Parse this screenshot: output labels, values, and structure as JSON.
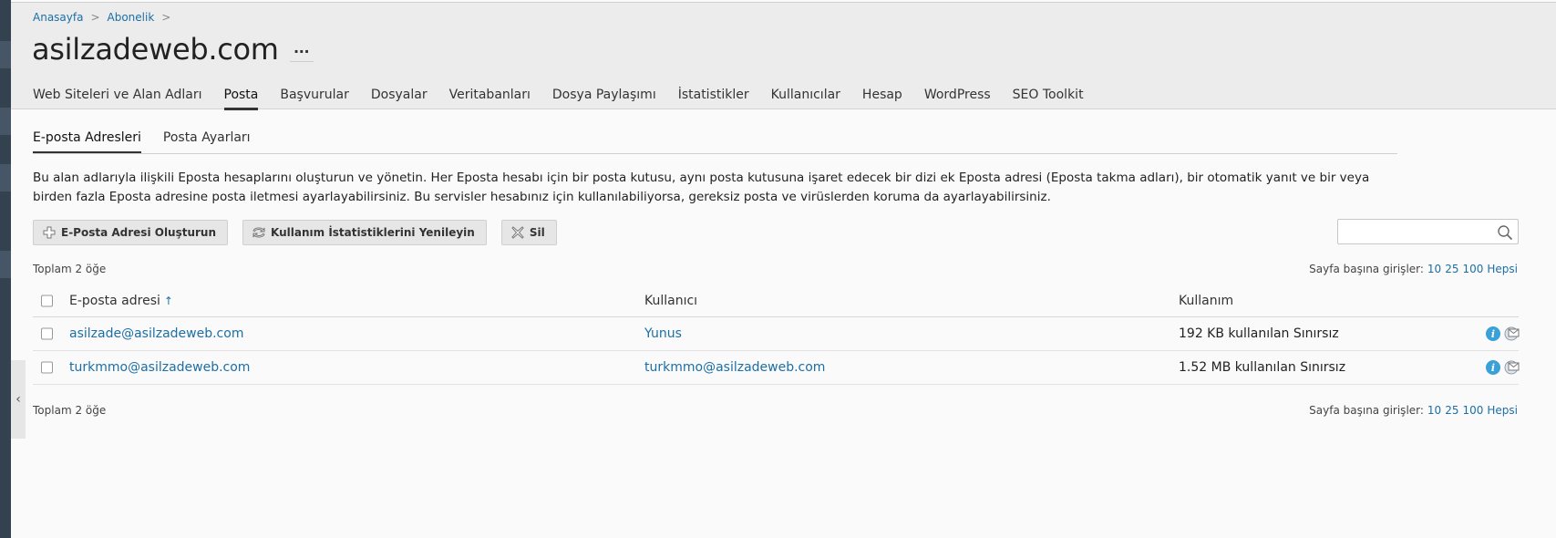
{
  "breadcrumb": {
    "items": [
      "Anasayfa",
      "Abonelik"
    ],
    "sep": ">"
  },
  "page": {
    "title": "asilzadeweb.com",
    "more_label": "···"
  },
  "main_tabs": [
    "Web Siteleri ve Alan Adları",
    "Posta",
    "Başvurular",
    "Dosyalar",
    "Veritabanları",
    "Dosya Paylaşımı",
    "İstatistikler",
    "Kullanıcılar",
    "Hesap",
    "WordPress",
    "SEO Toolkit"
  ],
  "main_tabs_active": "Posta",
  "sub_tabs": [
    "E-posta Adresleri",
    "Posta Ayarları"
  ],
  "sub_tabs_active": "E-posta Adresleri",
  "description": "Bu alan adlarıyla ilişkili Eposta hesaplarını oluşturun ve yönetin. Her Eposta hesabı için bir posta kutusu, aynı posta kutusuna işaret edecek bir dizi ek Eposta adresi (Eposta takma adları), bir otomatik yanıt ve bir veya birden fazla Eposta adresine posta iletmesi ayarlayabilirsiniz. Bu servisler hesabınız için kullanılabiliyorsa, gereksiz posta ve virüslerden koruma da ayarlayabilirsiniz.",
  "toolbar": {
    "create_label": "E-Posta Adresi Oluşturun",
    "refresh_label": "Kullanım İstatistiklerini Yenileyin",
    "delete_label": "Sil"
  },
  "search": {
    "value": "",
    "placeholder": ""
  },
  "list": {
    "total_label": "Toplam 2 öğe",
    "per_page_label": "Sayfa başına girişler:",
    "per_page_options": [
      "10",
      "25",
      "100",
      "Hepsi"
    ],
    "columns": {
      "email": "E-posta adresi",
      "sort_arrow": "↑",
      "user": "Kullanıcı",
      "usage": "Kullanım"
    },
    "rows": [
      {
        "email": "asilzade@asilzadeweb.com",
        "user": "Yunus",
        "usage": "192 KB kullanılan Sınırsız"
      },
      {
        "email": "turkmmo@asilzadeweb.com",
        "user": "turkmmo@asilzadeweb.com",
        "usage": "1.52 MB kullanılan Sınırsız"
      }
    ]
  },
  "icons": {
    "info": "i",
    "info_color": "#3aa0d8",
    "link_color": "#1c6fa5"
  }
}
